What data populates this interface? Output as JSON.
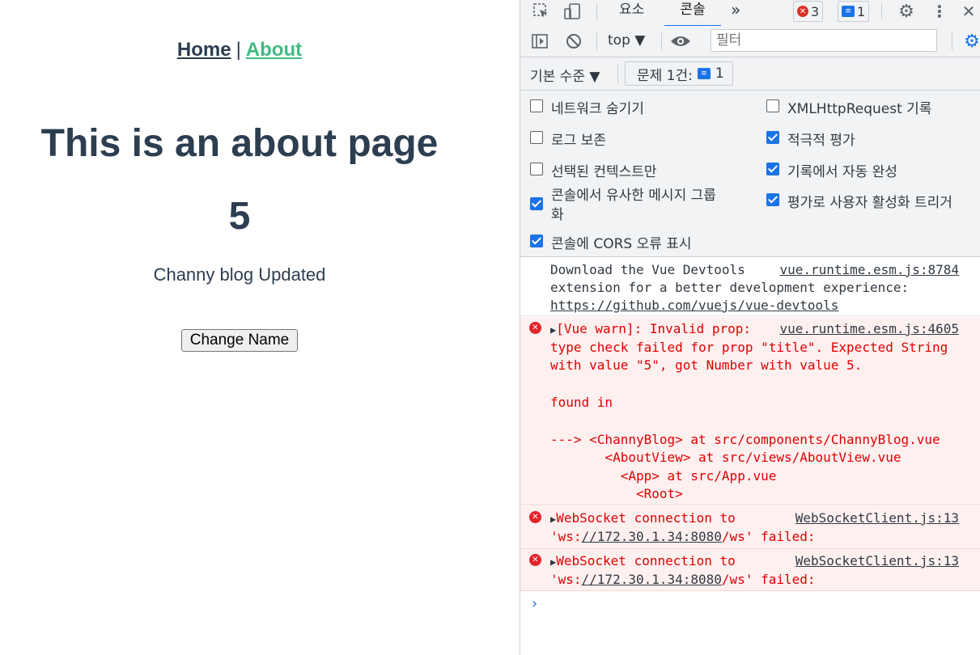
{
  "page": {
    "nav": {
      "home": "Home",
      "separator": "|",
      "about": "About"
    },
    "heading": "This is an about page",
    "number": "5",
    "blog_text": "Channy blog Updated",
    "button_label": "Change Name",
    "colors": {
      "text": "#2c3e50",
      "active_link": "#42b983"
    }
  },
  "devtools": {
    "tabs": {
      "elements": "요소",
      "console": "콘솔",
      "more": "»"
    },
    "badges": {
      "errors": "3",
      "messages": "1"
    },
    "context": "top ▼",
    "filter_placeholder": "필터",
    "level": "기본 수준 ▼",
    "issues_label": "문제 1건:",
    "issues_count": "1",
    "settings": {
      "hide_network": "네트워크 숨기기",
      "preserve_log": "로그 보존",
      "selected_context": "선택된 컨텍스트만",
      "group_similar": "콘솔에서 유사한 메시지 그룹",
      "group_similar_2": "화",
      "cors_errors": "콘솔에 CORS 오류 표시",
      "xhr_log": "XMLHttpRequest 기록",
      "eager_eval": "적극적 평가",
      "autocomplete": "기록에서 자동 완성",
      "user_activation": "평가로 사용자 활성화 트리거"
    },
    "messages": {
      "info": {
        "line1": "Download the Vue Devtools",
        "line2": "extension for a better development experience:",
        "link": "https://github.com/vuejs/vue-devtools",
        "source": "vue.runtime.esm.js:8784"
      },
      "warn": {
        "line1": "[Vue warn]: Invalid prop:",
        "line2": "type check failed for prop \"title\". Expected String",
        "line3": "with value \"5\", got Number with value 5.",
        "line4": "found in",
        "line5": "---> <ChannyBlog> at src/components/ChannyBlog.vue",
        "line6": "       <AboutView> at src/views/AboutView.vue",
        "line7": "         <App> at src/App.vue",
        "line8": "           <Root>",
        "source": "vue.runtime.esm.js:4605"
      },
      "ws1": {
        "line1": "WebSocket connection to",
        "prefix": "'ws:",
        "addr": "//172.30.1.34:8080",
        "suffix": "/ws' failed:",
        "source": "WebSocketClient.js:13"
      },
      "ws2": {
        "line1": "WebSocket connection to",
        "prefix": "'ws:",
        "addr": "//172.30.1.34:8080",
        "suffix": "/ws' failed:",
        "source": "WebSocketClient.js:13"
      }
    }
  }
}
